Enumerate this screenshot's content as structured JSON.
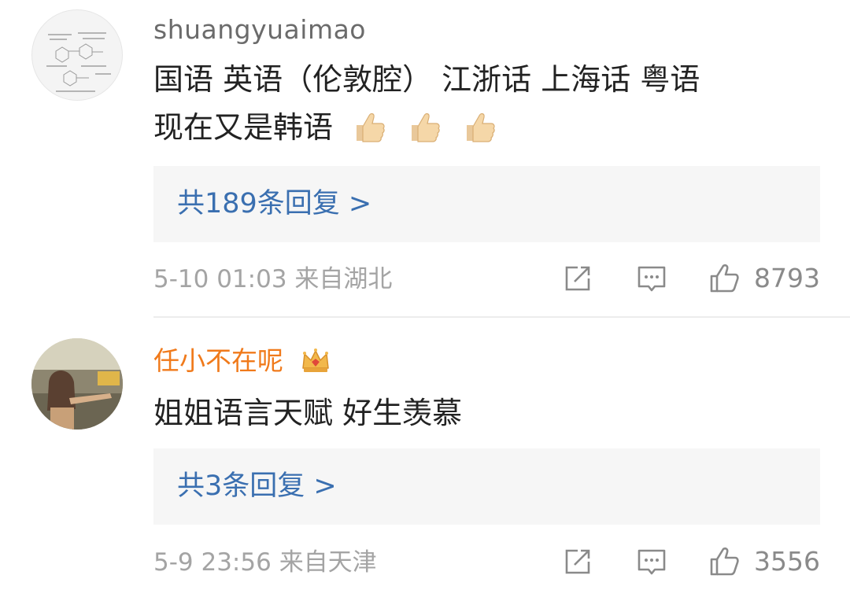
{
  "comments": [
    {
      "username": "shuangyuaimao",
      "text_line1": "国语  英语（伦敦腔） 江浙话  上海话  粤语",
      "text_line2": "现在又是韩语",
      "emojis": [
        "thumbs-up",
        "thumbs-up",
        "thumbs-up"
      ],
      "reply_label": "共189条回复 >",
      "timestamp": "5-10 01:03",
      "location": "来自湖北",
      "like_count": "8793"
    },
    {
      "username": "任小不在呢",
      "vip_badge": "crown-icon",
      "text_line1": "姐姐语言天赋 好生羡慕",
      "reply_label": "共3条回复 >",
      "timestamp": "5-9 23:56",
      "location": "来自天津",
      "like_count": "3556"
    }
  ],
  "colors": {
    "username_default": "#6b6b6b",
    "username_vip": "#f07a1b",
    "reply_link": "#3a6fb0",
    "meta_text": "#a4a4a4",
    "reply_bg": "#f6f6f6"
  },
  "icons": [
    "share-icon",
    "comment-icon",
    "like-icon"
  ]
}
